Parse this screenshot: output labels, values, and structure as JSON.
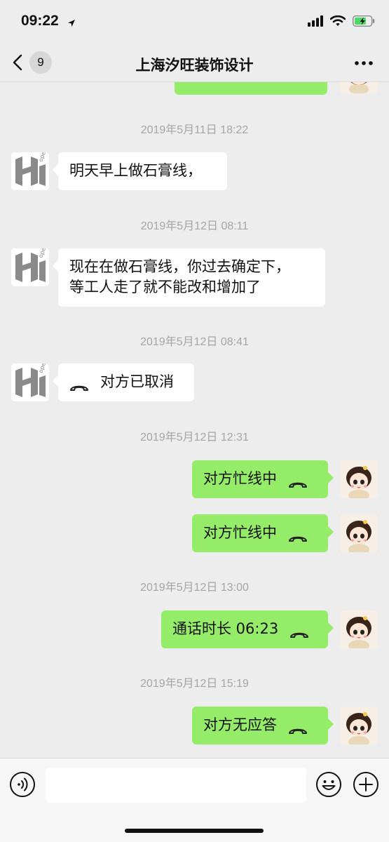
{
  "status_bar": {
    "time": "09:22",
    "icons": [
      "location-arrow-icon",
      "cellular-signal-icon",
      "wifi-icon",
      "battery-charging-icon"
    ]
  },
  "nav": {
    "back_icon": "chevron-left-icon",
    "unread_count": "9",
    "title": "上海汐旺装饰设计",
    "more_icon": "more-dots-icon"
  },
  "messages": {
    "ts1": "2019年5月11日 18:22",
    "m1": "明天早上做石膏线，",
    "ts2": "2019年5月12日 08:11",
    "m2_line1": "现在在做石膏线，你过去确定下，",
    "m2_line2": "等工人走了就不能改和增加了",
    "ts3": "2019年5月12日 08:41",
    "m3": "对方已取消",
    "ts4": "2019年5月12日 12:31",
    "m4": "对方忙线中",
    "m5": "对方忙线中",
    "ts5": "2019年5月12日 13:00",
    "m6": "通话时长 06:23",
    "ts6": "2019年5月12日 15:19",
    "m7": "对方无应答"
  },
  "input_bar": {
    "voice_icon": "voice-icon",
    "text_value": "",
    "emoji_icon": "emoji-icon",
    "plus_icon": "plus-icon"
  },
  "colors": {
    "background": "#ededed",
    "sent_bubble": "#95ec69",
    "received_bubble": "#ffffff",
    "timestamp_text": "#a5a5a5"
  }
}
